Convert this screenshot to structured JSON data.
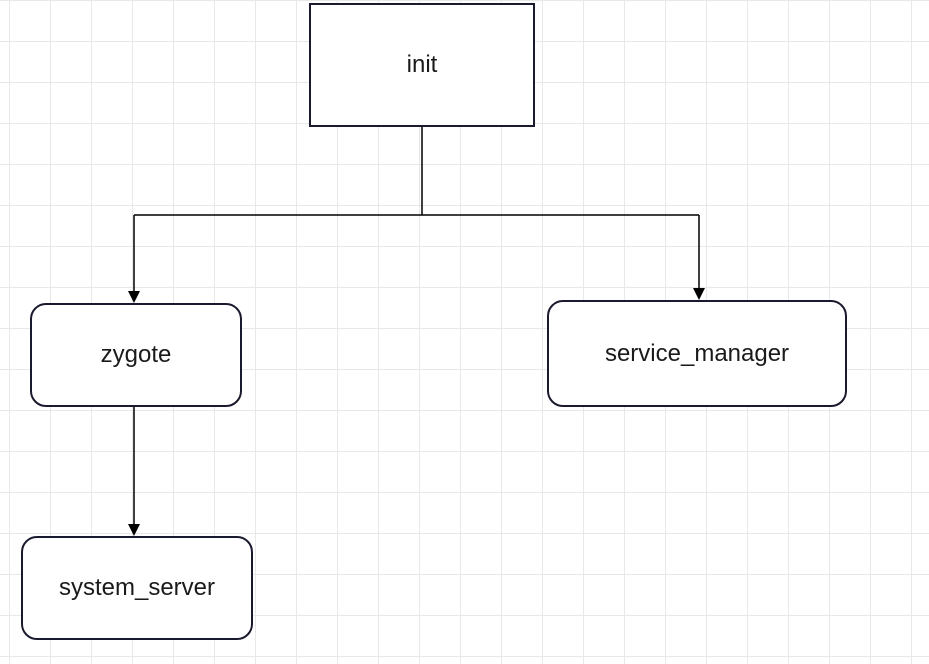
{
  "nodes": {
    "init": {
      "label": "init"
    },
    "zygote": {
      "label": "zygote"
    },
    "service_manager": {
      "label": "service_manager"
    },
    "system_server": {
      "label": "system_server"
    }
  },
  "edges": [
    {
      "from": "init",
      "to": "zygote"
    },
    {
      "from": "init",
      "to": "service_manager"
    },
    {
      "from": "zygote",
      "to": "system_server"
    }
  ]
}
